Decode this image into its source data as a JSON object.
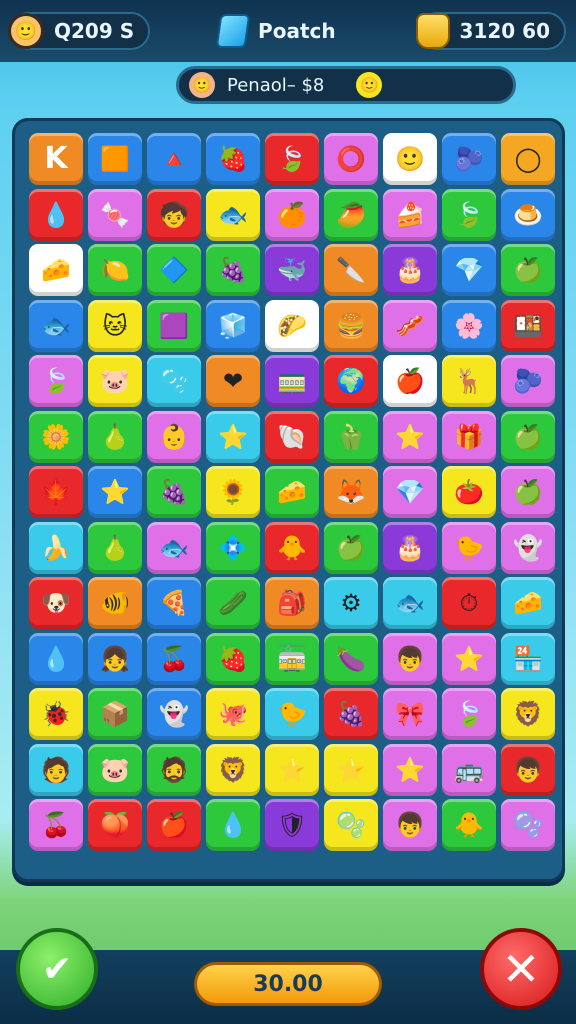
{
  "topbar": {
    "left_value": "Q209  S",
    "center_title": "Poatch",
    "right_value": "3120  60"
  },
  "subbar": {
    "text": "Penaol–  $8"
  },
  "actions": {
    "score_value": "30.00"
  },
  "colors": {
    "board_frame": "#1d5e86",
    "top_bar": "#0f3350",
    "score_button": "#f5a623",
    "confirm_button": "#3cc43a",
    "close_button": "#e01e1e"
  },
  "board": {
    "rows": [
      [
        {
          "c": "#f08a24",
          "i": "K"
        },
        {
          "c": "#2a86e8",
          "i": "🟧"
        },
        {
          "c": "#2a86e8",
          "i": "🔺"
        },
        {
          "c": "#2a86e8",
          "i": "🍓"
        },
        {
          "c": "#e8282a",
          "i": "🍃"
        },
        {
          "c": "#e070e8",
          "i": "⭕"
        },
        {
          "c": "#ffffff",
          "i": "🙂"
        },
        {
          "c": "#2a86e8",
          "i": "🫐"
        },
        {
          "c": "#f5a623",
          "i": "◯"
        }
      ],
      [
        {
          "c": "#e8282a",
          "i": "💧"
        },
        {
          "c": "#e070e8",
          "i": "🍬"
        },
        {
          "c": "#e8282a",
          "i": "🧒"
        },
        {
          "c": "#f5e61e",
          "i": "🐟"
        },
        {
          "c": "#e070e8",
          "i": "🍊"
        },
        {
          "c": "#2ec83c",
          "i": "🥭"
        },
        {
          "c": "#e070e8",
          "i": "🍰"
        },
        {
          "c": "#2ec83c",
          "i": "🍃"
        },
        {
          "c": "#2a86e8",
          "i": "🍮"
        }
      ],
      [
        {
          "c": "#ffffff",
          "i": "🧀"
        },
        {
          "c": "#2ec83c",
          "i": "🍋"
        },
        {
          "c": "#2ec83c",
          "i": "🔷"
        },
        {
          "c": "#2ec83c",
          "i": "🍇"
        },
        {
          "c": "#8a3ad8",
          "i": "🐳"
        },
        {
          "c": "#f08a24",
          "i": "🔪"
        },
        {
          "c": "#8a3ad8",
          "i": "🎂"
        },
        {
          "c": "#2a86e8",
          "i": "💎"
        },
        {
          "c": "#2ec83c",
          "i": "🍏"
        }
      ],
      [
        {
          "c": "#2a86e8",
          "i": "🐟"
        },
        {
          "c": "#f5e61e",
          "i": "🐱"
        },
        {
          "c": "#2ec83c",
          "i": "🟪"
        },
        {
          "c": "#2a86e8",
          "i": "🧊"
        },
        {
          "c": "#ffffff",
          "i": "🌮"
        },
        {
          "c": "#f08a24",
          "i": "🍔"
        },
        {
          "c": "#e070e8",
          "i": "🥓"
        },
        {
          "c": "#2a86e8",
          "i": "🌸"
        },
        {
          "c": "#e8282a",
          "i": "🍱"
        }
      ],
      [
        {
          "c": "#e070e8",
          "i": "🍃"
        },
        {
          "c": "#f5e61e",
          "i": "🐷"
        },
        {
          "c": "#3acbea",
          "i": "🫧"
        },
        {
          "c": "#f08a24",
          "i": "❤"
        },
        {
          "c": "#8a3ad8",
          "i": "🚃"
        },
        {
          "c": "#e8282a",
          "i": "🌍"
        },
        {
          "c": "#ffffff",
          "i": "🍎"
        },
        {
          "c": "#f5e61e",
          "i": "🦌"
        },
        {
          "c": "#e070e8",
          "i": "🫐"
        }
      ],
      [
        {
          "c": "#2ec83c",
          "i": "🌼"
        },
        {
          "c": "#2ec83c",
          "i": "🍐"
        },
        {
          "c": "#e070e8",
          "i": "👶"
        },
        {
          "c": "#3acbea",
          "i": "⭐"
        },
        {
          "c": "#e8282a",
          "i": "🐚"
        },
        {
          "c": "#2ec83c",
          "i": "🫑"
        },
        {
          "c": "#e070e8",
          "i": "⭐"
        },
        {
          "c": "#e070e8",
          "i": "🎁"
        },
        {
          "c": "#2ec83c",
          "i": "🍏"
        }
      ],
      [
        {
          "c": "#e8282a",
          "i": "🍁"
        },
        {
          "c": "#2a86e8",
          "i": "⭐"
        },
        {
          "c": "#2ec83c",
          "i": "🍇"
        },
        {
          "c": "#f5e61e",
          "i": "🌻"
        },
        {
          "c": "#2ec83c",
          "i": "🧀"
        },
        {
          "c": "#f08a24",
          "i": "🦊"
        },
        {
          "c": "#e070e8",
          "i": "💎"
        },
        {
          "c": "#f5e61e",
          "i": "🍅"
        },
        {
          "c": "#e070e8",
          "i": "🍏"
        }
      ],
      [
        {
          "c": "#3acbea",
          "i": "🍌"
        },
        {
          "c": "#2ec83c",
          "i": "🍐"
        },
        {
          "c": "#e070e8",
          "i": "🐟"
        },
        {
          "c": "#2ec83c",
          "i": "💠"
        },
        {
          "c": "#e8282a",
          "i": "🐥"
        },
        {
          "c": "#2ec83c",
          "i": "🍏"
        },
        {
          "c": "#8a3ad8",
          "i": "🎂"
        },
        {
          "c": "#e070e8",
          "i": "🐤"
        },
        {
          "c": "#e070e8",
          "i": "👻"
        }
      ],
      [
        {
          "c": "#e8282a",
          "i": "🐶"
        },
        {
          "c": "#f08a24",
          "i": "🐠"
        },
        {
          "c": "#2a86e8",
          "i": "🍕"
        },
        {
          "c": "#2ec83c",
          "i": "🥒"
        },
        {
          "c": "#f08a24",
          "i": "🎒"
        },
        {
          "c": "#3acbea",
          "i": "⚙"
        },
        {
          "c": "#3acbea",
          "i": "🐟"
        },
        {
          "c": "#e8282a",
          "i": "⏱"
        },
        {
          "c": "#3acbea",
          "i": "🧀"
        }
      ],
      [
        {
          "c": "#2a86e8",
          "i": "💧"
        },
        {
          "c": "#2a86e8",
          "i": "👧"
        },
        {
          "c": "#2a86e8",
          "i": "🍒"
        },
        {
          "c": "#2ec83c",
          "i": "🍓"
        },
        {
          "c": "#2ec83c",
          "i": "🚋"
        },
        {
          "c": "#2ec83c",
          "i": "🍆"
        },
        {
          "c": "#e070e8",
          "i": "👦"
        },
        {
          "c": "#e070e8",
          "i": "⭐"
        },
        {
          "c": "#3acbea",
          "i": "🏪"
        }
      ],
      [
        {
          "c": "#f5e61e",
          "i": "🐞"
        },
        {
          "c": "#2ec83c",
          "i": "📦"
        },
        {
          "c": "#2a86e8",
          "i": "👻"
        },
        {
          "c": "#f5e61e",
          "i": "🐙"
        },
        {
          "c": "#3acbea",
          "i": "🐤"
        },
        {
          "c": "#e8282a",
          "i": "🍇"
        },
        {
          "c": "#e070e8",
          "i": "🎀"
        },
        {
          "c": "#e070e8",
          "i": "🍃"
        },
        {
          "c": "#f5e61e",
          "i": "🦁"
        }
      ],
      [
        {
          "c": "#3acbea",
          "i": "🧑"
        },
        {
          "c": "#2ec83c",
          "i": "🐷"
        },
        {
          "c": "#2ec83c",
          "i": "🧔"
        },
        {
          "c": "#f5e61e",
          "i": "🦁"
        },
        {
          "c": "#f5e61e",
          "i": "⭐"
        },
        {
          "c": "#f5e61e",
          "i": "⭐"
        },
        {
          "c": "#e070e8",
          "i": "⭐"
        },
        {
          "c": "#e070e8",
          "i": "🚌"
        },
        {
          "c": "#e8282a",
          "i": "👦"
        }
      ],
      [
        {
          "c": "#e070e8",
          "i": "🍒"
        },
        {
          "c": "#e8282a",
          "i": "🍑"
        },
        {
          "c": "#e8282a",
          "i": "🍎"
        },
        {
          "c": "#2ec83c",
          "i": "💧"
        },
        {
          "c": "#8a3ad8",
          "i": "🛡"
        },
        {
          "c": "#f5e61e",
          "i": "🫧"
        },
        {
          "c": "#e070e8",
          "i": "👦"
        },
        {
          "c": "#2ec83c",
          "i": "🐥"
        },
        {
          "c": "#e070e8",
          "i": "🫧"
        }
      ]
    ]
  }
}
